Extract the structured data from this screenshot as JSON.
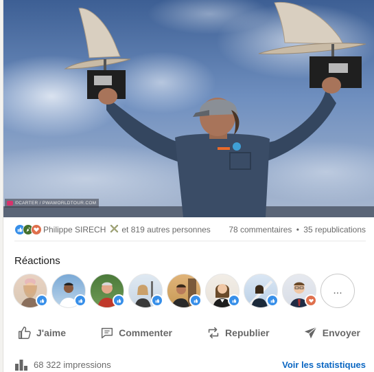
{
  "post": {
    "image": {
      "watermark": "©CARTER / PWAWORLDTOUR.COM"
    },
    "social_counts": {
      "reaction_types": [
        "like-icon",
        "celebrate-icon",
        "love-icon"
      ],
      "reactor_name": "Philippe SIRECH",
      "reactor_emoji": "❌",
      "others_text": "et 819 autres personnes",
      "comments_text": "78 commentaires",
      "separator": "•",
      "reposts_text": "35 republications"
    },
    "reactions": {
      "title": "Réactions",
      "avatars": [
        {
          "reaction": "like",
          "bg": "#d9c9b6"
        },
        {
          "reaction": "like",
          "bg": "#7aa9d6"
        },
        {
          "reaction": "like",
          "bg": "#4b7a3a"
        },
        {
          "reaction": "like",
          "bg": "#c9d6e4"
        },
        {
          "reaction": "like",
          "bg": "#c89a56"
        },
        {
          "reaction": "like",
          "bg": "#e8e2da"
        },
        {
          "reaction": "like",
          "bg": "#b9cfe6"
        },
        {
          "reaction": "love",
          "bg": "#d8dde6"
        }
      ],
      "more_label": "..."
    },
    "actions": {
      "like": "J'aime",
      "comment": "Commenter",
      "repost": "Republier",
      "send": "Envoyer"
    },
    "analytics": {
      "impressions": "68 322 impressions",
      "stats_link": "Voir les statistiques"
    }
  },
  "colors": {
    "link": "#0a66c2",
    "like": "#378fe9",
    "love": "#df704d",
    "celebrate": "#44712e"
  }
}
